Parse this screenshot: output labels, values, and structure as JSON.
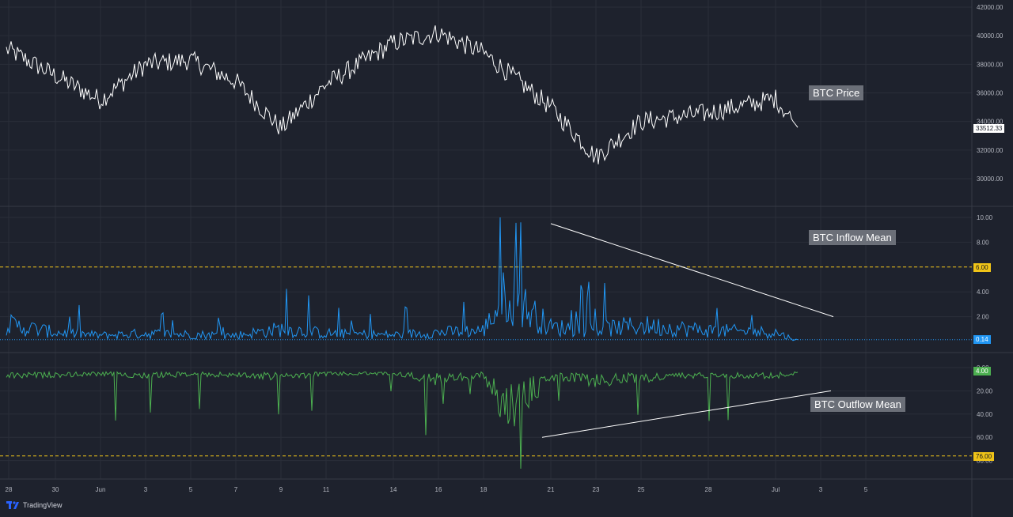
{
  "brand": {
    "name": "TradingView",
    "icon": "tradingview-logo-icon"
  },
  "colors": {
    "background": "#1e222d",
    "grid": "#2a2e39",
    "price": "#ffffff",
    "inflow": "#2196f3",
    "outflow": "#4caf50",
    "level": "#f0c418",
    "trendline": "#ffffff"
  },
  "x_axis": {
    "labels": [
      "28",
      "30",
      "Jun",
      "3",
      "5",
      "7",
      "9",
      "11",
      "14",
      "16",
      "18",
      "21",
      "23",
      "25",
      "28",
      "Jul",
      "3",
      "5"
    ]
  },
  "panes": {
    "price": {
      "label": "BTC Price",
      "current_tag": "33512.33",
      "y_ticks": [
        "42000.00",
        "40000.00",
        "38000.00",
        "36000.00",
        "34000.00",
        "32000.00",
        "30000.00"
      ]
    },
    "inflow": {
      "label": "BTC Inflow Mean",
      "current_tag": "0.14",
      "level_tag": "6.00",
      "y_ticks": [
        "10.00",
        "8.00",
        "6.00",
        "4.00",
        "2.00"
      ]
    },
    "outflow": {
      "label": "BTC Outflow Mean",
      "current_tag": "4.00",
      "level_tag": "76.00",
      "y_ticks": [
        "0.00",
        "20.00",
        "40.00",
        "60.00",
        "80.00"
      ]
    }
  },
  "chart_data": [
    {
      "type": "line",
      "title": "BTC Price",
      "x": [
        "May 28",
        "May 30",
        "Jun 1",
        "Jun 3",
        "Jun 5",
        "Jun 7",
        "Jun 9",
        "Jun 11",
        "Jun 14",
        "Jun 16",
        "Jun 18",
        "Jun 21",
        "Jun 23",
        "Jun 25",
        "Jun 28",
        "Jul 1",
        "Jul 2"
      ],
      "series": [
        {
          "name": "BTC Price",
          "values": [
            39000,
            37200,
            35500,
            38000,
            38300,
            36800,
            33500,
            36600,
            39500,
            40200,
            38800,
            35000,
            31500,
            34000,
            34600,
            35600,
            33512
          ]
        }
      ],
      "ylim": [
        28000,
        42000
      ],
      "current_value": 33512.33
    },
    {
      "type": "line",
      "title": "BTC Inflow Mean",
      "x": [
        "May 28",
        "May 30",
        "Jun 1",
        "Jun 3",
        "Jun 5",
        "Jun 7",
        "Jun 9",
        "Jun 11",
        "Jun 14",
        "Jun 16",
        "Jun 18",
        "Jun 19",
        "Jun 21",
        "Jun 23",
        "Jun 25",
        "Jun 28",
        "Jul 1",
        "Jul 2"
      ],
      "series": [
        {
          "name": "BTC Inflow Mean",
          "values": [
            3.3,
            1.8,
            1.2,
            1.6,
            1.4,
            1.2,
            2.5,
            1.6,
            1.3,
            1.8,
            2.2,
            9.6,
            2.8,
            2.4,
            3.2,
            2.2,
            1.8,
            0.14
          ]
        }
      ],
      "ylim": [
        0,
        11
      ],
      "reference_level": 6.0,
      "trendline": {
        "from": [
          "Jun 21",
          9.5
        ],
        "to": [
          "Jul 3",
          2.0
        ]
      }
    },
    {
      "type": "line",
      "title": "BTC Outflow Mean",
      "x": [
        "May 28",
        "May 30",
        "Jun 1",
        "Jun 3",
        "Jun 5",
        "Jun 7",
        "Jun 9",
        "Jun 11",
        "Jun 14",
        "Jun 16",
        "Jun 18",
        "Jun 19",
        "Jun 21",
        "Jun 23",
        "Jun 25",
        "Jun 28",
        "Jul 1",
        "Jul 2"
      ],
      "series": [
        {
          "name": "BTC Outflow Mean",
          "values": [
            10,
            8,
            6,
            9,
            7,
            8,
            12,
            6,
            5,
            18,
            7,
            87,
            12,
            20,
            15,
            8,
            10,
            4
          ]
        }
      ],
      "ylim": [
        0,
        88
      ],
      "reference_level": 76.0,
      "trendline": {
        "from": [
          "Jun 20",
          60
        ],
        "to": [
          "Jul 3",
          20
        ]
      }
    }
  ]
}
